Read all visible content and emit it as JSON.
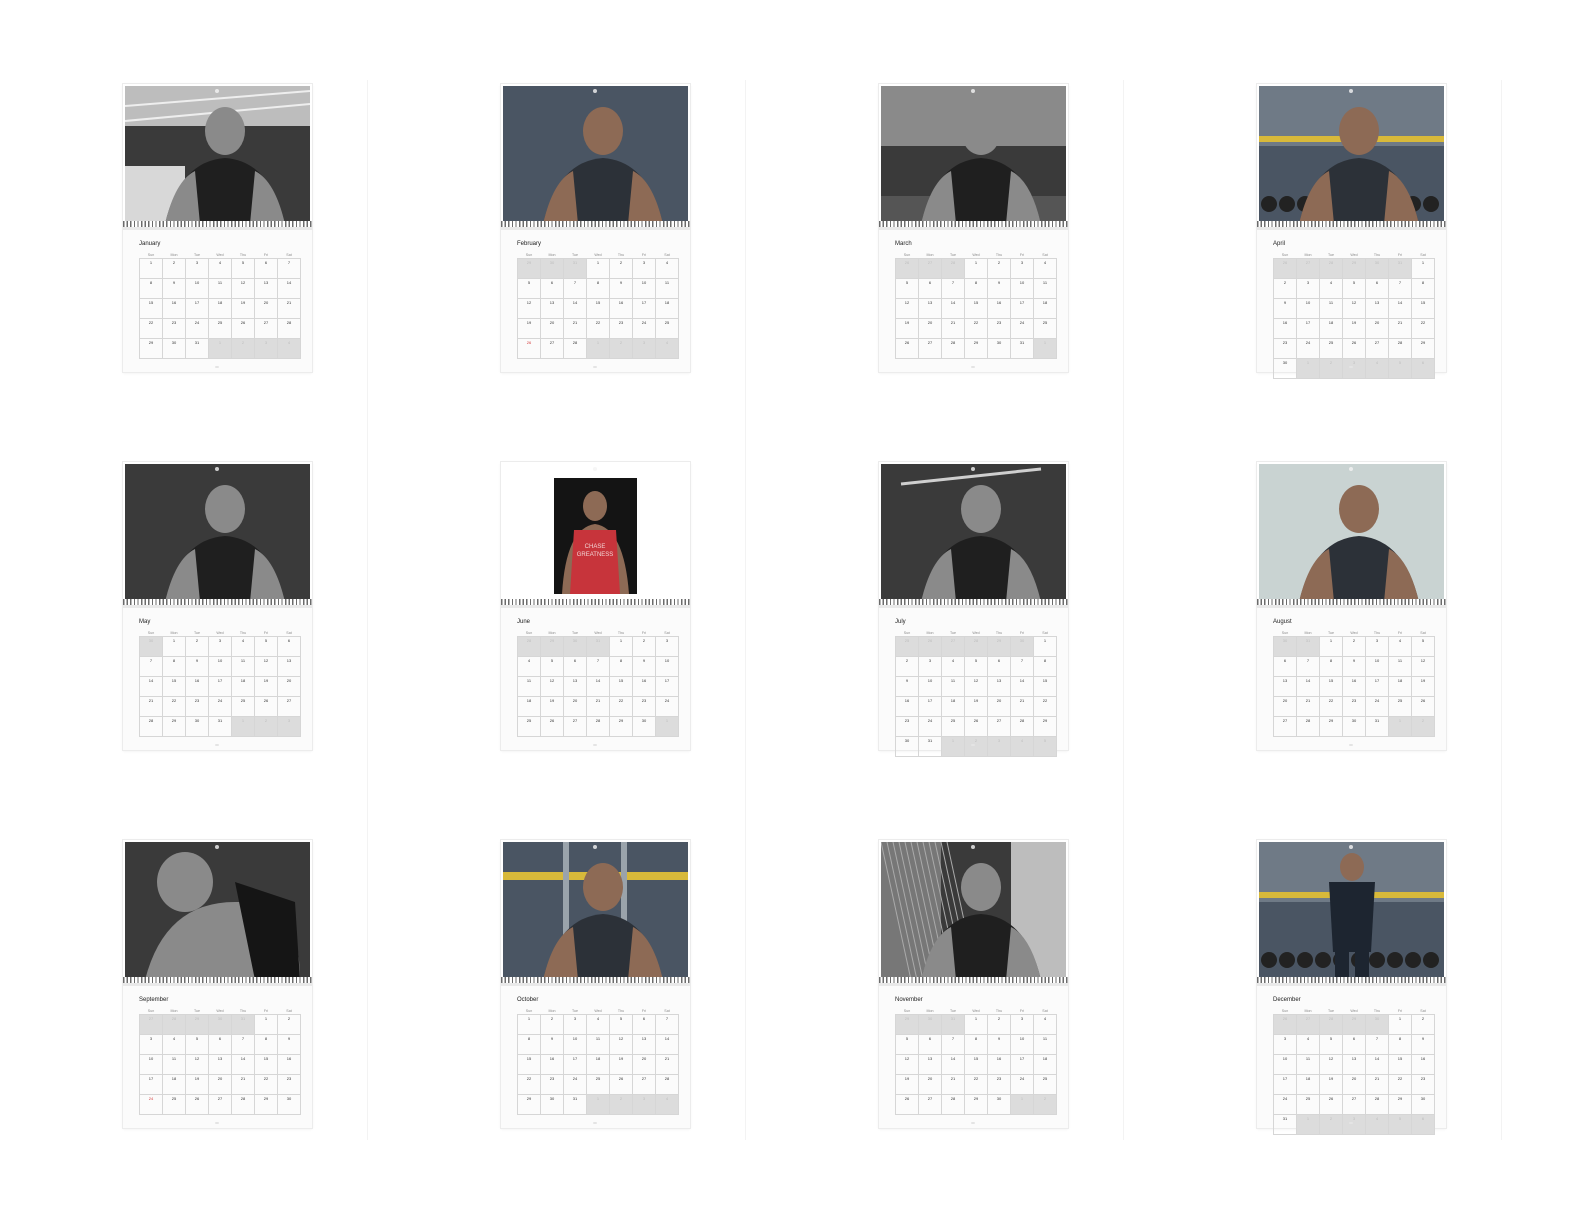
{
  "weekdays": [
    "Sun",
    "Mon",
    "Tue",
    "Wed",
    "Thu",
    "Fri",
    "Sat"
  ],
  "months": [
    {
      "name": "January",
      "offset": 0,
      "days": 31,
      "prev_days": 31,
      "photo": "bw-gym-lookup",
      "highlight": []
    },
    {
      "name": "February",
      "offset": 3,
      "days": 28,
      "prev_days": 31,
      "photo": "color-dark-tank",
      "highlight": [
        26
      ]
    },
    {
      "name": "March",
      "offset": 3,
      "days": 31,
      "prev_days": 28,
      "photo": "bw-seated-curl",
      "highlight": []
    },
    {
      "name": "April",
      "offset": 6,
      "days": 30,
      "prev_days": 31,
      "photo": "color-dumbbell-rack",
      "highlight": []
    },
    {
      "name": "May",
      "offset": 1,
      "days": 31,
      "prev_days": 30,
      "photo": "bw-tshirt-portrait",
      "highlight": []
    },
    {
      "name": "June",
      "offset": 4,
      "days": 30,
      "prev_days": 31,
      "photo": "color-red-tank-framed",
      "highlight": []
    },
    {
      "name": "July",
      "offset": 6,
      "days": 31,
      "prev_days": 30,
      "photo": "bw-cable-pulldown",
      "highlight": []
    },
    {
      "name": "August",
      "offset": 2,
      "days": 31,
      "prev_days": 31,
      "photo": "color-hooded-portrait",
      "highlight": []
    },
    {
      "name": "September",
      "offset": 5,
      "days": 30,
      "prev_days": 31,
      "photo": "bw-tattoo-back",
      "highlight": [
        24
      ]
    },
    {
      "name": "October",
      "offset": 0,
      "days": 31,
      "prev_days": 30,
      "photo": "color-hooded-machine",
      "highlight": []
    },
    {
      "name": "November",
      "offset": 3,
      "days": 30,
      "prev_days": 31,
      "photo": "bw-doorway-cage",
      "highlight": []
    },
    {
      "name": "December",
      "offset": 5,
      "days": 31,
      "prev_days": 30,
      "photo": "color-back-dumbbells",
      "highlight": []
    }
  ],
  "tank_print": "CHASE GREATNESS",
  "colors": {
    "bw_bg": "#2b2b2b",
    "color_bg": "#3b4652",
    "red_tank": "#c7343b",
    "grid_out": "#dcdcdc"
  }
}
